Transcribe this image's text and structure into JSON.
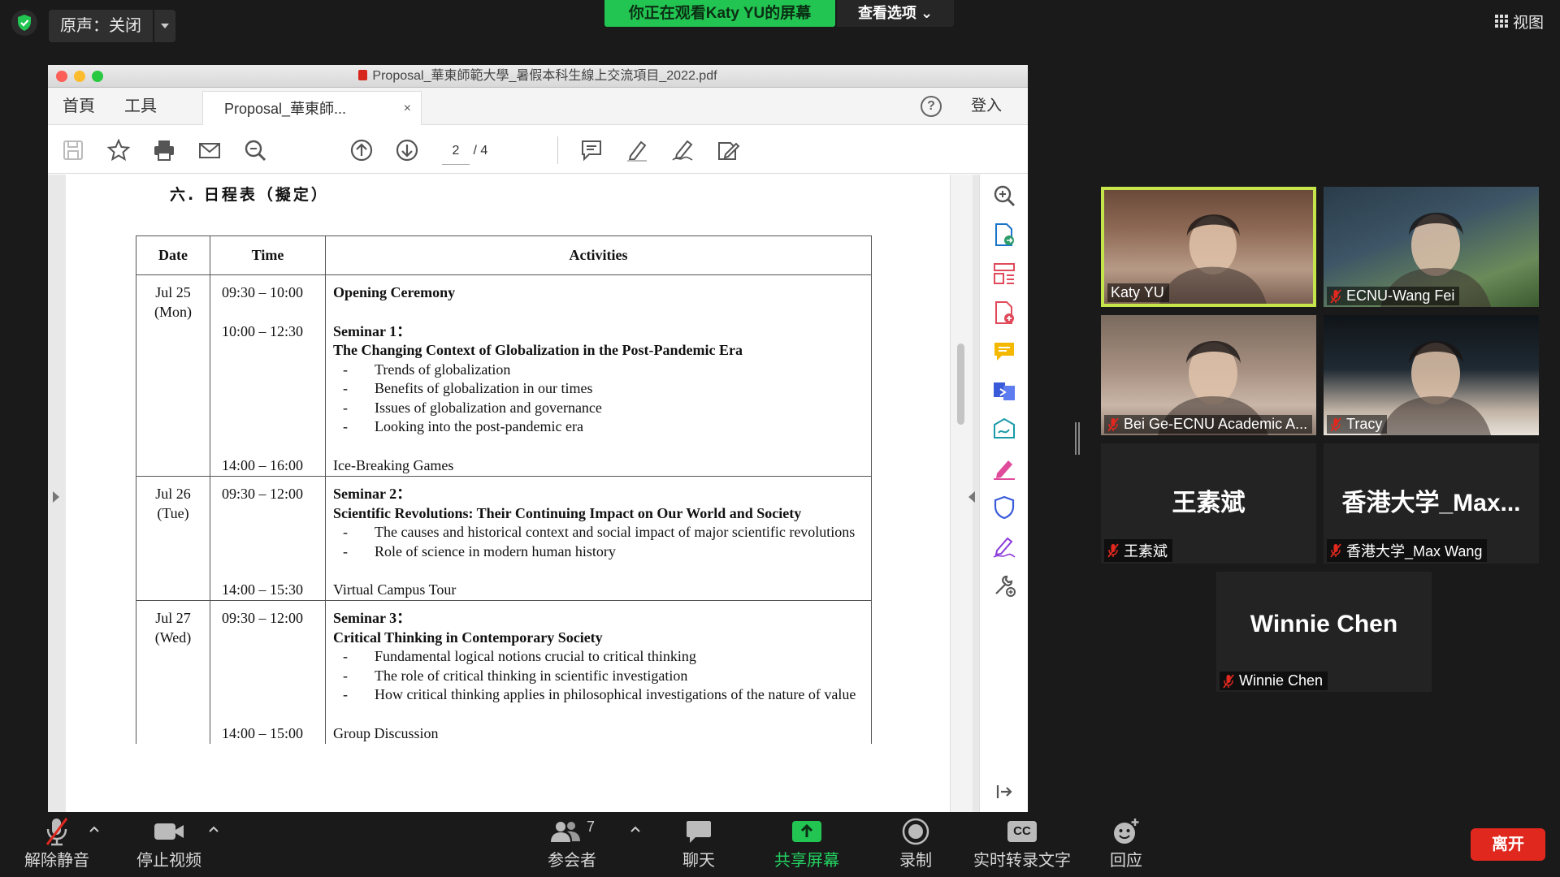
{
  "zoom": {
    "original_sound_label": "原声：关闭",
    "viewing_banner": "你正在观看Katy YU的屏幕",
    "view_options": "查看选项",
    "view_button": "视图"
  },
  "pdf": {
    "window_title": "Proposal_華東師範大學_暑假本科生線上交流項目_2022.pdf",
    "menu_home": "首頁",
    "menu_tools": "工具",
    "tab_title": "Proposal_華東師...",
    "tab_close": "×",
    "help": "?",
    "login": "登入",
    "page_current": "2",
    "page_total": "/ 4",
    "heading": "六. 日程表（擬定）",
    "table_headers": [
      "Date",
      "Time",
      "Activities"
    ],
    "days": [
      {
        "date": "Jul 25",
        "weekday": "(Mon)",
        "slots": [
          {
            "time": "09:30 – 10:00",
            "title": "Opening Ceremony",
            "subtitle": "",
            "items": [],
            "plain": ""
          },
          {
            "time": "10:00 – 12:30",
            "title": "Seminar 1：",
            "subtitle": "The Changing Context of Globalization in the Post-Pandemic Era",
            "items": [
              "Trends of globalization",
              "Benefits of globalization in our times",
              "Issues of globalization and governance",
              "Looking into the post-pandemic era"
            ],
            "plain": ""
          },
          {
            "time": "14:00 – 16:00",
            "title": "",
            "subtitle": "",
            "items": [],
            "plain": "Ice-Breaking Games"
          }
        ]
      },
      {
        "date": "Jul 26",
        "weekday": "(Tue)",
        "slots": [
          {
            "time": "09:30 – 12:00",
            "title": "Seminar 2：",
            "subtitle": "Scientific Revolutions: Their Continuing Impact on Our World and Society",
            "items": [
              "The causes and historical context and social impact of major scientific revolutions",
              "Role of science in modern human history"
            ],
            "plain": ""
          },
          {
            "time": "14:00 – 15:30",
            "title": "",
            "subtitle": "",
            "items": [],
            "plain": "Virtual Campus Tour"
          }
        ]
      },
      {
        "date": "Jul 27",
        "weekday": "(Wed)",
        "slots": [
          {
            "time": "09:30 – 12:00",
            "title": "Seminar 3：",
            "subtitle": "Critical Thinking in Contemporary Society",
            "items": [
              "Fundamental logical notions crucial to critical thinking",
              "The role of critical thinking in scientific investigation",
              "How critical thinking applies in philosophical investigations of the nature of value"
            ],
            "plain": ""
          },
          {
            "time": "14:00 – 15:00",
            "title": "",
            "subtitle": "",
            "items": [],
            "plain": "Group Discussion"
          }
        ]
      }
    ]
  },
  "participants": [
    {
      "name": "Katy YU",
      "display": "",
      "muted": false,
      "active": true,
      "video": "katy"
    },
    {
      "name": "ECNU-Wang Fei",
      "display": "",
      "muted": true,
      "active": false,
      "video": "wangfei"
    },
    {
      "name": "Bei Ge-ECNU Academic A...",
      "display": "",
      "muted": true,
      "active": false,
      "video": "beige"
    },
    {
      "name": "Tracy",
      "display": "",
      "muted": true,
      "active": false,
      "video": "tracy"
    },
    {
      "name": "王素斌",
      "display": "王素斌",
      "muted": true,
      "active": false,
      "video": ""
    },
    {
      "name": "香港大学_Max Wang",
      "display": "香港大学_Max...",
      "muted": true,
      "active": false,
      "video": ""
    },
    {
      "name": "Winnie Chen",
      "display": "Winnie Chen",
      "muted": true,
      "active": false,
      "video": ""
    }
  ],
  "bottom": {
    "unmute": "解除静音",
    "stop_video": "停止视频",
    "participants": "参会者",
    "participant_count": "7",
    "chat": "聊天",
    "share": "共享屏幕",
    "record": "录制",
    "cc_badge": "CC",
    "transcript": "实时转录文字",
    "reactions": "回应",
    "leave": "离开"
  },
  "colors": {
    "accent_green": "#23c552",
    "active_speaker": "#c6e54a",
    "leave_red": "#e0281f"
  }
}
